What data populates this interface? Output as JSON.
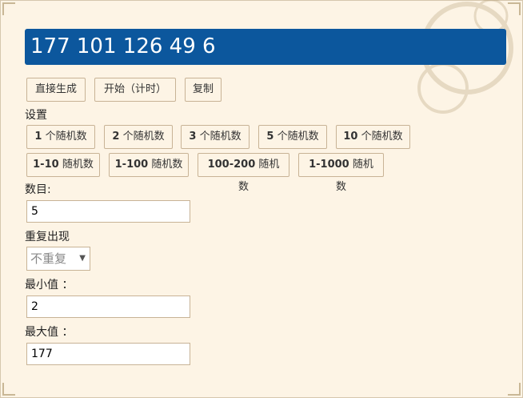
{
  "result": "177 101 126 49 6",
  "actions": {
    "generate": "直接生成",
    "start": "开始（计时）",
    "copy": "复制"
  },
  "settings_label": "设置",
  "count_presets": [
    {
      "num": "1",
      "unit": "个随机数"
    },
    {
      "num": "2",
      "unit": "个随机数"
    },
    {
      "num": "3",
      "unit": "个随机数"
    },
    {
      "num": "5",
      "unit": "个随机数"
    },
    {
      "num": "10",
      "unit": "个随机数"
    }
  ],
  "range_presets": [
    {
      "range": "1-10",
      "unit": "随机数"
    },
    {
      "range": "1-100",
      "unit": "随机数"
    },
    {
      "range": "100-200",
      "unit": "随机数"
    },
    {
      "range": "1-1000",
      "unit": "随机数"
    }
  ],
  "form": {
    "count_label": "数目:",
    "count_value": "5",
    "repeat_label": "重复出现",
    "repeat_value": "不重复",
    "min_label": "最小值 ：",
    "min_value": "2",
    "max_label": "最大值 ：",
    "max_value": "177"
  }
}
